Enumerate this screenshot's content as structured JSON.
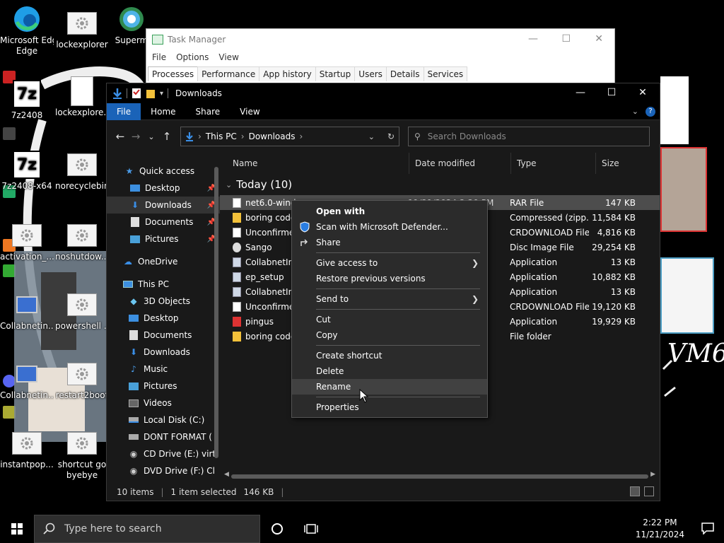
{
  "desktop": {
    "icons": [
      {
        "label": "Microsoft Edge",
        "label2": ""
      },
      {
        "label": "lockexplorer",
        "label2": ""
      },
      {
        "label": "Superm",
        "label2": ""
      },
      {
        "label": "7z2408",
        "label2": ""
      },
      {
        "label": "lockexplore...",
        "label2": ""
      },
      {
        "label": "7z2408-x64",
        "label2": ""
      },
      {
        "label": "norecyclebin",
        "label2": ""
      },
      {
        "label": "activation_...",
        "label2": ""
      },
      {
        "label": "noshutdow...",
        "label2": ""
      },
      {
        "label": "Collabnetin...",
        "label2": ""
      },
      {
        "label": "powershell ...",
        "label2": ""
      },
      {
        "label": "Collabnetin...",
        "label2": ""
      },
      {
        "label": "restart2boot",
        "label2": ""
      },
      {
        "label": "instantpop...",
        "label2": ""
      },
      {
        "label": "shortcut go",
        "label2": "byebye"
      }
    ],
    "scribble_text": "VM6"
  },
  "task_manager": {
    "title": "Task Manager",
    "menu": [
      "File",
      "Options",
      "View"
    ],
    "tabs": [
      "Processes",
      "Performance",
      "App history",
      "Startup",
      "Users",
      "Details",
      "Services"
    ],
    "active_tab": "Processes"
  },
  "explorer": {
    "title": "Downloads",
    "ribbon_tabs": [
      "File",
      "Home",
      "Share",
      "View"
    ],
    "address": {
      "crumbs": [
        "This PC",
        "Downloads"
      ]
    },
    "search_placeholder": "Search Downloads",
    "nav": {
      "quick_access": "Quick access",
      "quick_items": [
        "Desktop",
        "Downloads",
        "Documents",
        "Pictures"
      ],
      "onedrive": "OneDrive",
      "this_pc": "This PC",
      "pc_items": [
        "3D Objects",
        "Desktop",
        "Documents",
        "Downloads",
        "Music",
        "Pictures",
        "Videos",
        "Local Disk (C:)",
        "DONT FORMAT (",
        "CD Drive (E:) virt",
        "DVD Drive (F:) Cl"
      ]
    },
    "columns": {
      "name": "Name",
      "date": "Date modified",
      "type": "Type",
      "size": "Size"
    },
    "group": "Today (10)",
    "files": [
      {
        "name": "net6.0-windows.rar",
        "date": "11/21/2024 2:20 PM",
        "type": "RAR File",
        "size": "147 KB",
        "icon": "file-icon"
      },
      {
        "name": "boring code",
        "date": "",
        "type": "Compressed (zipp...",
        "size": "11,584 KB",
        "icon": "zip-folder-icon"
      },
      {
        "name": "Unconfirmed",
        "date": "",
        "type": "CRDOWNLOAD File",
        "size": "4,816 KB",
        "icon": "file-icon"
      },
      {
        "name": "Sango",
        "date": "",
        "type": "Disc Image File",
        "size": "29,254 KB",
        "icon": "disc-image-icon"
      },
      {
        "name": "CollabnetIns",
        "date": "",
        "type": "Application",
        "size": "13 KB",
        "icon": "app-icon"
      },
      {
        "name": "ep_setup",
        "date": "",
        "type": "Application",
        "size": "10,882 KB",
        "icon": "app-icon"
      },
      {
        "name": "CollabnetIns",
        "date": "M",
        "type": "Application",
        "size": "13 KB",
        "icon": "app-icon"
      },
      {
        "name": "Unconfirme",
        "date": "M",
        "type": "CRDOWNLOAD File",
        "size": "19,120 KB",
        "icon": "file-icon"
      },
      {
        "name": "pingus",
        "date": "M",
        "type": "Application",
        "size": "19,929 KB",
        "icon": "app-red-icon"
      },
      {
        "name": "boring code",
        "date": "",
        "type": "File folder",
        "size": "",
        "icon": "folder-icon"
      }
    ],
    "status": {
      "items": "10 items",
      "selected": "1 item selected",
      "size": "146 KB"
    }
  },
  "context_menu": {
    "items": [
      {
        "label": "Open with",
        "bold": true
      },
      {
        "label": "Scan with Microsoft Defender...",
        "icon": "shield-icon"
      },
      {
        "label": "Share",
        "icon": "share-icon"
      },
      {
        "label": "Give access to",
        "submenu": true
      },
      {
        "label": "Restore previous versions"
      },
      {
        "label": "Send to",
        "submenu": true
      },
      {
        "label": "Cut"
      },
      {
        "label": "Copy"
      },
      {
        "label": "Create shortcut"
      },
      {
        "label": "Delete"
      },
      {
        "label": "Rename"
      },
      {
        "label": "Properties"
      }
    ],
    "hovered": "Rename"
  },
  "taskbar": {
    "search_placeholder": "Type here to search",
    "time": "2:22 PM",
    "date": "11/21/2024"
  },
  "colors": {
    "accent": "#1a63b8",
    "explorer_bg": "#191919",
    "menu_bg": "#2b2b2b",
    "selection": "#4d4d4d"
  }
}
